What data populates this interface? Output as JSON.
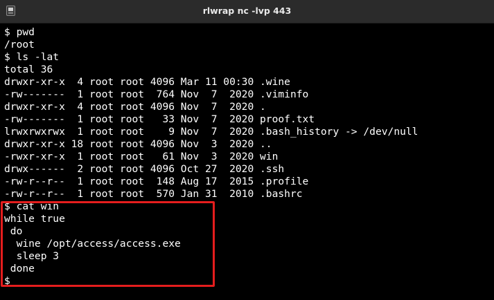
{
  "window": {
    "title": "rlwrap nc -lvp 443",
    "app_icon": "terminal-icon"
  },
  "terminal": {
    "lines": [
      "$ pwd",
      "/root",
      "$ ls -lat",
      "total 36",
      "drwxr-xr-x  4 root root 4096 Mar 11 00:30 .wine",
      "-rw-------  1 root root  764 Nov  7  2020 .viminfo",
      "drwxr-xr-x  4 root root 4096 Nov  7  2020 .",
      "-rw-------  1 root root   33 Nov  7  2020 proof.txt",
      "lrwxrwxrwx  1 root root    9 Nov  7  2020 .bash_history -> /dev/null",
      "drwxr-xr-x 18 root root 4096 Nov  3  2020 ..",
      "-rwxr-xr-x  1 root root   61 Nov  3  2020 win",
      "drwx------  2 root root 4096 Oct 27  2020 .ssh",
      "-rw-r--r--  1 root root  148 Aug 17  2015 .profile",
      "-rw-r--r--  1 root root  570 Jan 31  2010 .bashrc",
      "$ cat win",
      "while true",
      " do",
      "  wine /opt/access/access.exe",
      "  sleep 3",
      " done",
      "$"
    ]
  },
  "colors": {
    "background": "#000000",
    "text": "#ffffff",
    "titlebar": "#2b2b2b",
    "highlight": "#e51d1d"
  }
}
